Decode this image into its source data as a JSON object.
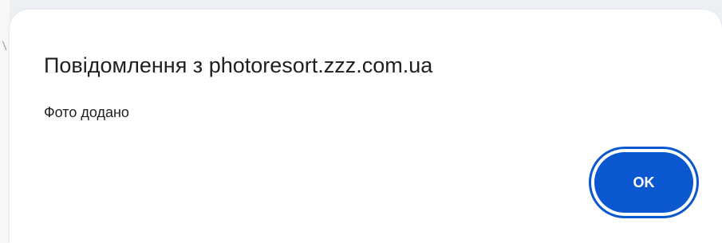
{
  "dialog": {
    "title": "Повідомлення з photoresort.zzz.com.ua",
    "message": "Фото додано",
    "ok_button_label": "OK"
  },
  "colors": {
    "primary_button": "#0b57d0",
    "dialog_background": "#ffffff",
    "page_background": "#eceff3",
    "text": "#1f1f1f"
  }
}
